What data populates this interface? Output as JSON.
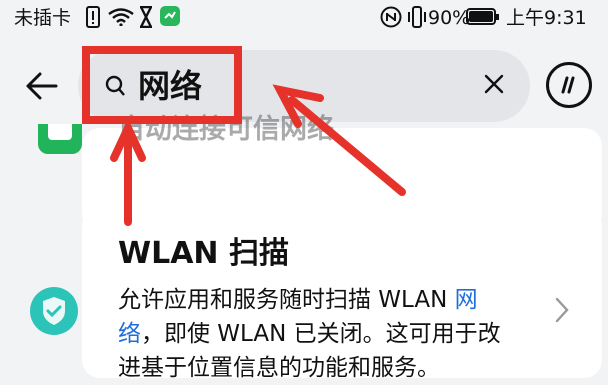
{
  "status_bar": {
    "carrier": "未插卡",
    "battery": "90%",
    "time": "上午9:31"
  },
  "search": {
    "query": "网络"
  },
  "results": {
    "partial_title": "自动连接可信网络",
    "wlan_scan": {
      "title": "WLAN 扫描",
      "desc_part1": "允许应用和服务随时扫描 WLAN ",
      "desc_highlight1": "网",
      "desc_highlight2": "络",
      "desc_part2": "，即使 WLAN 已关闭。这可用于改",
      "desc_part3": "进基于位置信息的功能和服务。"
    }
  },
  "colors": {
    "annotation_red": "#e5322a",
    "highlight_blue": "#1e6fdb",
    "shield_teal": "#2cc3b9",
    "green_icon": "#22b45a"
  }
}
